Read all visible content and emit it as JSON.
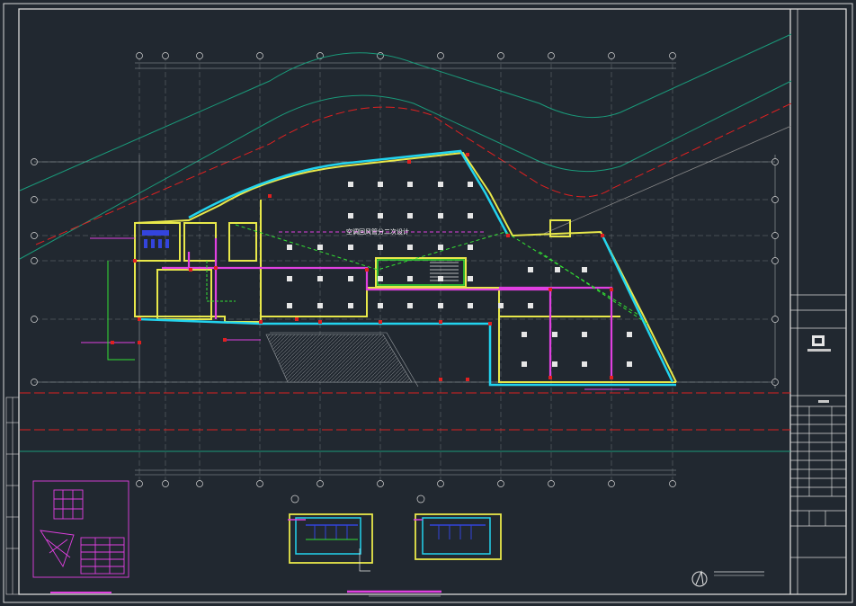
{
  "drawing": {
    "center_label": "空调回风管分二次设计",
    "title_block_logo": "logo-mark"
  },
  "colors": {
    "background": "#212830",
    "frame": "#d8d8d8",
    "grid": "#6f7478",
    "wall_yellow": "#e8e84a",
    "duct_cyan": "#22d3ee",
    "duct_magenta": "#e040e0",
    "pipe_green": "#33e033",
    "road_red": "#e02020",
    "road_teal": "#1a9a7a",
    "hatch_white": "#e6e6e6"
  },
  "icons": [
    "north-arrow-icon",
    "logo-mark"
  ]
}
